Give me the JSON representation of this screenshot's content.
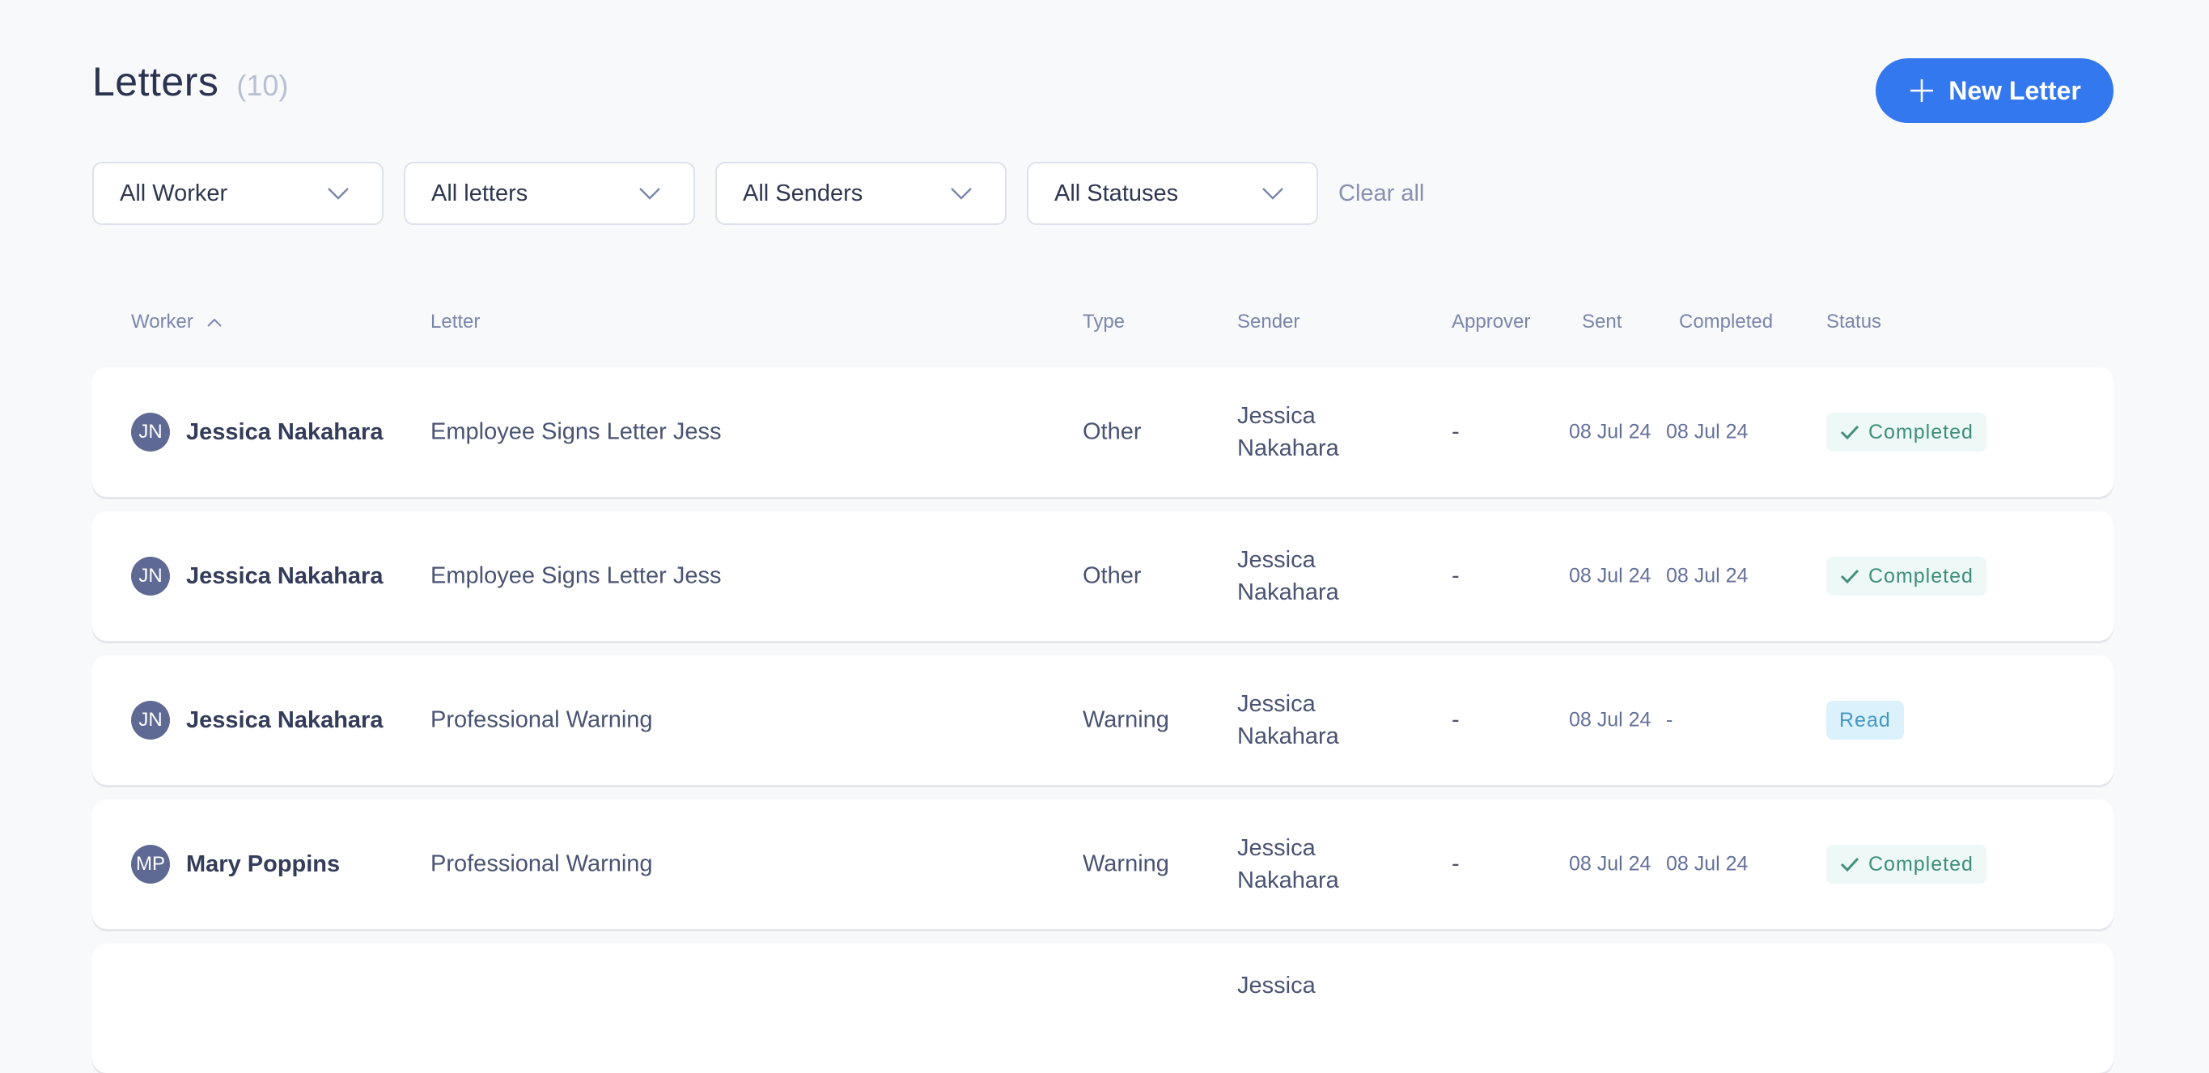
{
  "header": {
    "title": "Letters",
    "count": "(10)",
    "new_button_label": "New Letter",
    "new_button_icon": "plus-icon"
  },
  "colors": {
    "accent": "#3478f0",
    "avatar": "#5f6a94",
    "completed_bg": "#eef8f6",
    "completed_fg": "#3e8f7b",
    "read_bg": "#dbf1fc",
    "read_fg": "#4497c4"
  },
  "filters": [
    {
      "value": "All Worker"
    },
    {
      "value": "All letters"
    },
    {
      "value": "All Senders"
    },
    {
      "value": "All Statuses"
    }
  ],
  "clear_all_label": "Clear all",
  "columns": {
    "worker": "Worker",
    "letter": "Letter",
    "type": "Type",
    "sender": "Sender",
    "approver": "Approver",
    "sent": "Sent",
    "completed": "Completed",
    "status": "Status"
  },
  "sort": {
    "column": "worker",
    "direction": "ascending"
  },
  "rows": [
    {
      "initials": "JN",
      "worker": "Jessica Nakahara",
      "letter": "Employee Signs Letter Jess",
      "type": "Other",
      "sender": "Jessica Nakahara",
      "approver": "-",
      "sent": "08 Jul 24",
      "completed": "08 Jul 24",
      "status": "Completed"
    },
    {
      "initials": "JN",
      "worker": "Jessica Nakahara",
      "letter": "Employee Signs Letter Jess",
      "type": "Other",
      "sender": "Jessica Nakahara",
      "approver": "-",
      "sent": "08 Jul 24",
      "completed": "08 Jul 24",
      "status": "Completed"
    },
    {
      "initials": "JN",
      "worker": "Jessica Nakahara",
      "letter": "Professional Warning",
      "type": "Warning",
      "sender": "Jessica Nakahara",
      "approver": "-",
      "sent": "08 Jul 24",
      "completed": "-",
      "status": "Read"
    },
    {
      "initials": "MP",
      "worker": "Mary Poppins",
      "letter": "Professional Warning",
      "type": "Warning",
      "sender": "Jessica Nakahara",
      "approver": "-",
      "sent": "08 Jul 24",
      "completed": "08 Jul 24",
      "status": "Completed"
    }
  ],
  "partial_row": {
    "sender": "Jessica"
  }
}
